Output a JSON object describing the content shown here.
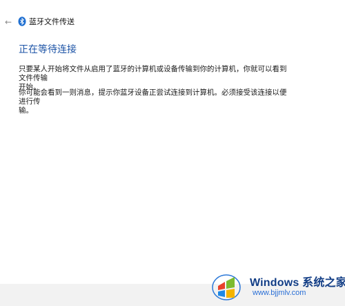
{
  "window": {
    "title": "蓝牙文件传送",
    "back_icon": "back-arrow-icon",
    "app_icon": "bluetooth-icon"
  },
  "main": {
    "heading": "正在等待连接",
    "paragraph_1": "只要某人开始将文件从启用了蓝牙的计算机或设备传输到你的计算机，你就可以看到文件传输\n开始。",
    "paragraph_2": "你可能会看到一则消息，提示你蓝牙设备正尝试连接到计算机。必须接受该连接以便进行传\n输。"
  },
  "watermark": {
    "title": "Windows 系统之家",
    "url": "www.bjjmlv.com",
    "logo_icon": "windows-logo-icon"
  },
  "colors": {
    "heading": "#1c53a6",
    "text": "#1a1a1a",
    "footer": "#f2f2f2",
    "watermark_title": "#123d85",
    "watermark_url": "#2a6fd6"
  }
}
